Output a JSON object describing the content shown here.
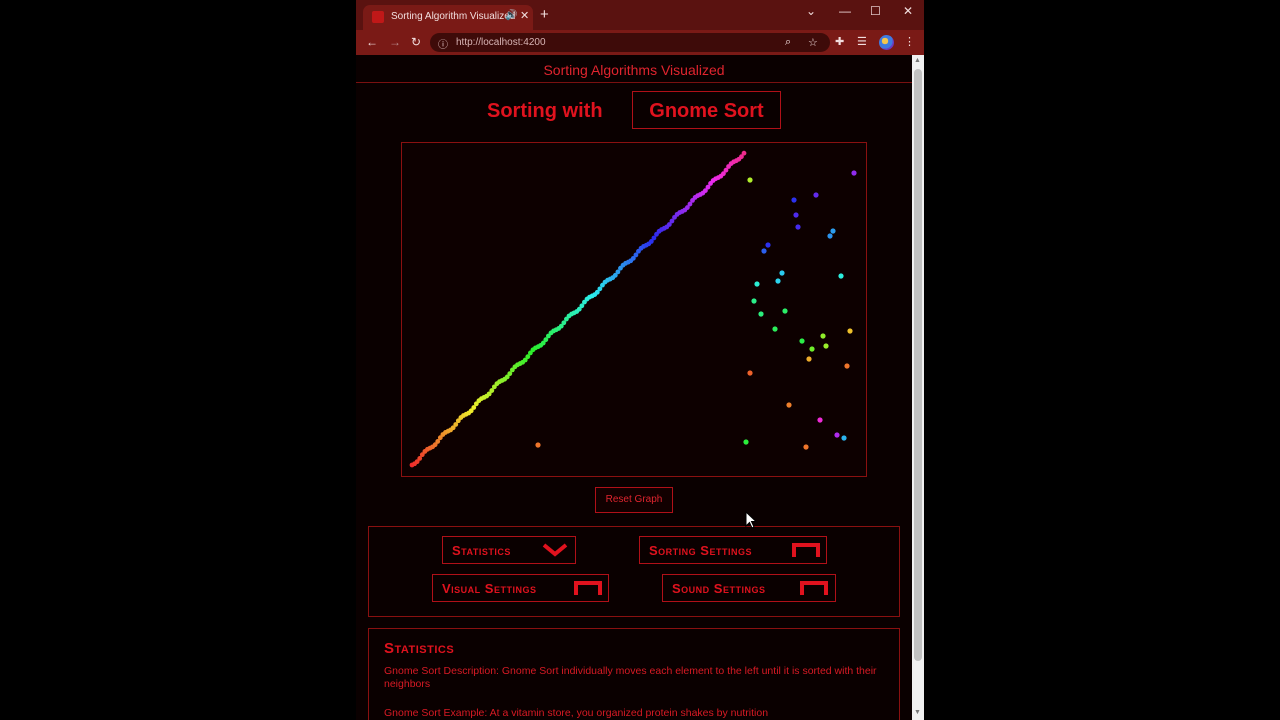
{
  "browser": {
    "tab_title": "Sorting Algorithm Visualized",
    "url_host": "http://localhost",
    "url_port": ":4200",
    "icons": [
      "back-icon",
      "forward-icon",
      "reload-icon",
      "info-icon",
      "zoom-icon",
      "star-icon",
      "extensions-icon",
      "reading-list-icon",
      "profile-icon",
      "menu-icon"
    ]
  },
  "site": {
    "title": "Sorting Algorithms Visualized",
    "heading_prefix": "Sorting with",
    "algorithm": "Gnome Sort"
  },
  "graph": {
    "reset_label": "Reset Graph"
  },
  "menus": {
    "statistics": "Statistics",
    "sorting_settings": "Sorting Settings",
    "visual_settings": "Visual Settings",
    "sound_settings": "Sound Settings"
  },
  "stats": {
    "title": "Statistics",
    "description": "Gnome Sort Description: Gnome Sort individually moves each element to the left until it is sorted with their neighbors",
    "example": "Gnome Sort Example: At a vitamin store, you organized protein shakes by nutrition"
  },
  "colors": {
    "accent": "#e0121e",
    "background": "#0a0000",
    "browser_frame": "#7a1a16"
  },
  "chart_data": {
    "type": "scatter",
    "color_scale": "hue by value: red (low) → orange → yellow → green → blue → violet → pink (high)",
    "sorted_prefix": {
      "count": 130,
      "y_range_note": "values increase monotonically from lowest to highest"
    },
    "unsorted_points_hue": [
      0.07,
      0.24,
      0.72,
      0.78,
      0.82,
      0.76,
      0.75,
      0.72,
      0.68,
      0.62,
      0.63,
      0.58,
      0.57,
      0.52,
      0.53,
      0.45,
      0.44,
      0.42,
      0.41,
      0.39,
      0.3,
      0.27,
      0.26,
      0.12,
      0.14,
      0.07,
      0.05,
      0.08,
      0.93,
      0.85,
      0.6,
      0.38
    ]
  }
}
